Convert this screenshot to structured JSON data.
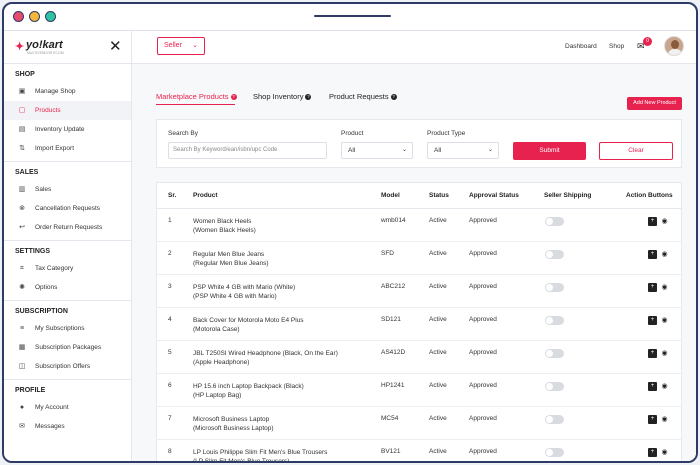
{
  "brand": {
    "name": "yo!kart",
    "tagline": "MULTIVENDOR ECOM"
  },
  "colors": {
    "accent": "#e8224f",
    "frame": "#2f3b66"
  },
  "sidebar": {
    "sections": [
      {
        "title": "SHOP",
        "items": [
          {
            "label": "Manage Shop",
            "icon": "store-icon"
          },
          {
            "label": "Products",
            "icon": "box-icon",
            "active": true
          },
          {
            "label": "Inventory Update",
            "icon": "clipboard-icon"
          },
          {
            "label": "Import Export",
            "icon": "import-export-icon"
          }
        ]
      },
      {
        "title": "SALES",
        "items": [
          {
            "label": "Sales",
            "icon": "bar-chart-icon"
          },
          {
            "label": "Cancellation Requests",
            "icon": "cancel-icon"
          },
          {
            "label": "Order Return Requests",
            "icon": "return-icon"
          }
        ]
      },
      {
        "title": "SETTINGS",
        "items": [
          {
            "label": "Tax Category",
            "icon": "tag-icon"
          },
          {
            "label": "Options",
            "icon": "gear-icon"
          }
        ]
      },
      {
        "title": "SUBSCRIPTION",
        "items": [
          {
            "label": "My Subscriptions",
            "icon": "subscription-icon"
          },
          {
            "label": "Subscription Packages",
            "icon": "package-icon"
          },
          {
            "label": "Subscription Offers",
            "icon": "offer-icon"
          }
        ]
      },
      {
        "title": "PROFILE",
        "items": [
          {
            "label": "My Account",
            "icon": "user-icon"
          },
          {
            "label": "Messages",
            "icon": "message-icon"
          }
        ]
      }
    ]
  },
  "topbar": {
    "seller_label": "Seller",
    "dashboard_label": "Dashboard",
    "shop_label": "Shop",
    "mail_badge": "0"
  },
  "tabs": [
    {
      "label": "Marketplace Products",
      "active": true
    },
    {
      "label": "Shop Inventory"
    },
    {
      "label": "Product Requests"
    }
  ],
  "add_button": "Add New Product",
  "filters": {
    "search_label": "Search By",
    "search_placeholder": "Search By Keyword/ean/isbn/upc Code",
    "product_label": "Product",
    "product_value": "All",
    "type_label": "Product Type",
    "type_value": "All",
    "submit_label": "Submit",
    "clear_label": "Clear"
  },
  "table": {
    "headers": [
      "Sr.",
      "Product",
      "Model",
      "Status",
      "Approval Status",
      "Seller Shipping",
      "Action Buttons"
    ],
    "rows": [
      {
        "sr": "1",
        "name": "Women Black Heels",
        "sub": "(Women Black Heels)",
        "model": "wmb014",
        "status": "Active",
        "approval": "Approved"
      },
      {
        "sr": "2",
        "name": "Regular Men Blue Jeans",
        "sub": "(Regular Men Blue Jeans)",
        "model": "SFD",
        "status": "Active",
        "approval": "Approved"
      },
      {
        "sr": "3",
        "name": "PSP White 4 GB with Mario (White)",
        "sub": "(PSP White 4 GB with Mario)",
        "model": "ABC212",
        "status": "Active",
        "approval": "Approved"
      },
      {
        "sr": "4",
        "name": "Back Cover for Motorola Moto E4 Plus",
        "sub": "(Motorola Case)",
        "model": "SD121",
        "status": "Active",
        "approval": "Approved"
      },
      {
        "sr": "5",
        "name": "JBL T250SI Wired Headphone (Black, On the Ear)",
        "sub": "(Apple Headphone)",
        "model": "AS412D",
        "status": "Active",
        "approval": "Approved"
      },
      {
        "sr": "6",
        "name": "HP 15.6 inch Laptop Backpack (Black)",
        "sub": "(HP Laptop Bag)",
        "model": "HP1241",
        "status": "Active",
        "approval": "Approved"
      },
      {
        "sr": "7",
        "name": "Microsoft Business Laptop",
        "sub": "(Microsoft Business Laptop)",
        "model": "MC54",
        "status": "Active",
        "approval": "Approved"
      },
      {
        "sr": "8",
        "name": "LP Louis Philippe Slim Fit Men's Blue Trousers",
        "sub": "(LP Slim Fit Men's Blue Trousers)",
        "model": "BV121",
        "status": "Active",
        "approval": "Approved"
      }
    ]
  }
}
